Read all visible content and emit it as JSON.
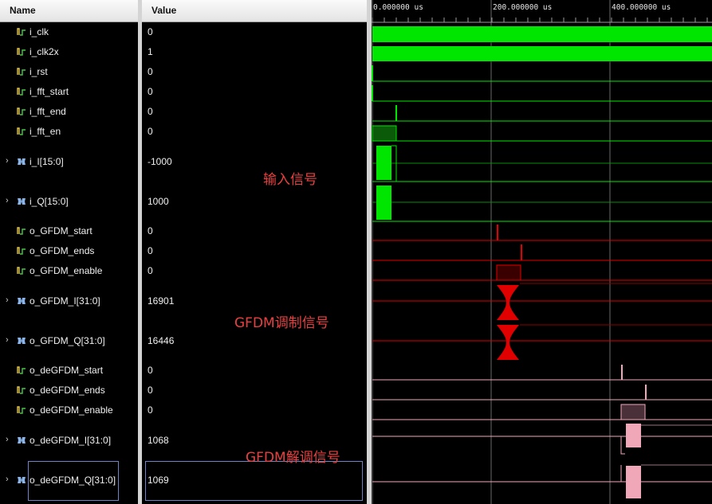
{
  "headers": {
    "name": "Name",
    "value": "Value"
  },
  "time_ruler": {
    "labels": [
      "0.000000 us",
      "200.000000 us",
      "400.000000 us"
    ]
  },
  "signals": [
    {
      "name": "i_clk",
      "value": "0",
      "kind": "bit"
    },
    {
      "name": "i_clk2x",
      "value": "1",
      "kind": "bit"
    },
    {
      "name": "i_rst",
      "value": "0",
      "kind": "bit"
    },
    {
      "name": "i_fft_start",
      "value": "0",
      "kind": "bit"
    },
    {
      "name": "i_fft_end",
      "value": "0",
      "kind": "bit"
    },
    {
      "name": "i_fft_en",
      "value": "0",
      "kind": "bit"
    },
    {
      "name": "i_I[15:0]",
      "value": "-1000",
      "kind": "bus"
    },
    {
      "name": "i_Q[15:0]",
      "value": "1000",
      "kind": "bus"
    },
    {
      "name": "o_GFDM_start",
      "value": "0",
      "kind": "bit"
    },
    {
      "name": "o_GFDM_ends",
      "value": "0",
      "kind": "bit"
    },
    {
      "name": "o_GFDM_enable",
      "value": "0",
      "kind": "bit"
    },
    {
      "name": "o_GFDM_I[31:0]",
      "value": "16901",
      "kind": "bus"
    },
    {
      "name": "o_GFDM_Q[31:0]",
      "value": "16446",
      "kind": "bus"
    },
    {
      "name": "o_deGFDM_start",
      "value": "0",
      "kind": "bit"
    },
    {
      "name": "o_deGFDM_ends",
      "value": "0",
      "kind": "bit"
    },
    {
      "name": "o_deGFDM_enable",
      "value": "0",
      "kind": "bit"
    },
    {
      "name": "o_deGFDM_I[31:0]",
      "value": "1068",
      "kind": "bus"
    },
    {
      "name": "o_deGFDM_Q[31:0]",
      "value": "1069",
      "kind": "bus"
    }
  ],
  "annotations": {
    "input": "输入信号",
    "modulated": "GFDM调制信号",
    "demodulated": "GFDM解调信号"
  },
  "colors": {
    "input_wave": "#00e600",
    "gfdm_wave": "#e00000",
    "degfdm_wave": "#f0a8b8",
    "annotation": "#e84040"
  }
}
